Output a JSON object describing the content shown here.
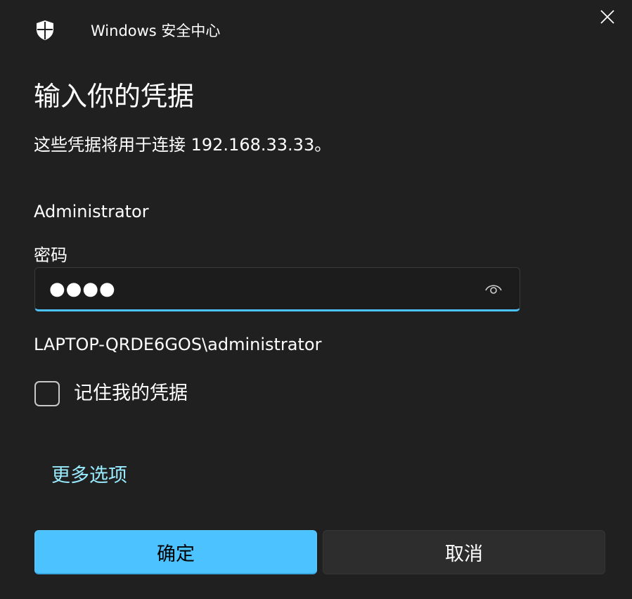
{
  "window": {
    "app_title": "Windows 安全中心",
    "app_icon": "shield-icon",
    "close_icon": "close-icon"
  },
  "dialog": {
    "heading": "输入你的凭据",
    "subtext": "这些凭据将用于连接 192.168.33.33。",
    "username": "Administrator",
    "password_label": "密码",
    "password_value": "●●●●",
    "reveal_icon": "eye-icon",
    "domain_user": "LAPTOP-QRDE6GOS\\administrator",
    "remember_label": "记住我的凭据",
    "remember_checked": false,
    "more_options": "更多选项"
  },
  "buttons": {
    "ok": "确定",
    "cancel": "取消"
  },
  "colors": {
    "accent": "#4cc2ff",
    "link": "#99ebff",
    "background": "#202020"
  }
}
